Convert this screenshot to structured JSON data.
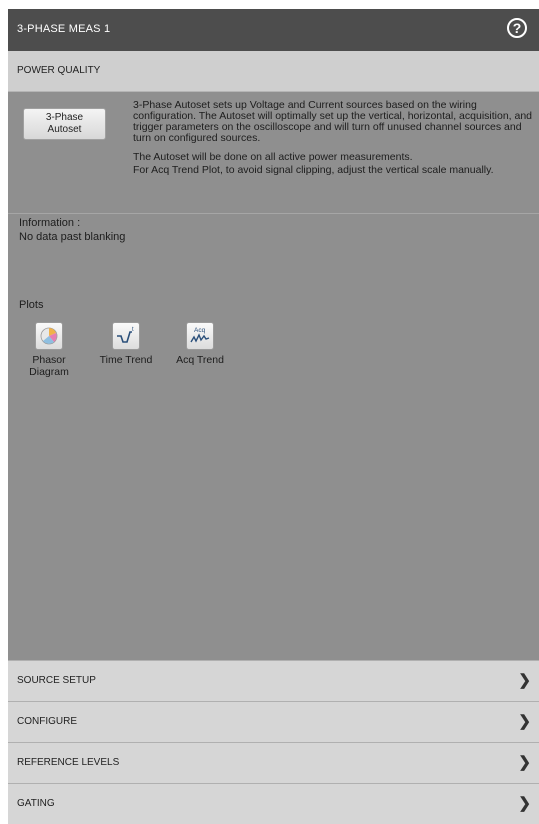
{
  "title": "3-PHASE MEAS 1",
  "help_icon": "help-circle-icon",
  "power_quality": {
    "header": "POWER QUALITY",
    "autoset_button": {
      "line1": "3-Phase",
      "line2": "Autoset"
    },
    "description": {
      "para1": "3-Phase Autoset sets up Voltage and Current sources based on the wiring configuration. The Autoset will optimally set up the vertical, horizontal, acquisition, and trigger parameters on the oscilloscope and will turn off unused channel sources and turn on configured sources.",
      "para2": "The Autoset will be done on all active power measurements.",
      "para3": "For Acq Trend Plot, to avoid signal clipping, adjust the vertical scale manually."
    },
    "information_label": "Information :",
    "information_value": "No data past blanking",
    "plots_label": "Plots",
    "plots": [
      {
        "line1": "Phasor",
        "line2": "Diagram",
        "icon": "phasor-diagram-icon"
      },
      {
        "line1": "Time Trend",
        "line2": "",
        "icon": "time-trend-icon"
      },
      {
        "line1": "Acq Trend",
        "line2": "",
        "icon": "acq-trend-icon",
        "icon_text": "Acq"
      }
    ]
  },
  "sections": [
    {
      "label": "SOURCE SETUP"
    },
    {
      "label": "CONFIGURE"
    },
    {
      "label": "REFERENCE LEVELS"
    },
    {
      "label": "GATING"
    }
  ],
  "chevron_glyph": "❯"
}
